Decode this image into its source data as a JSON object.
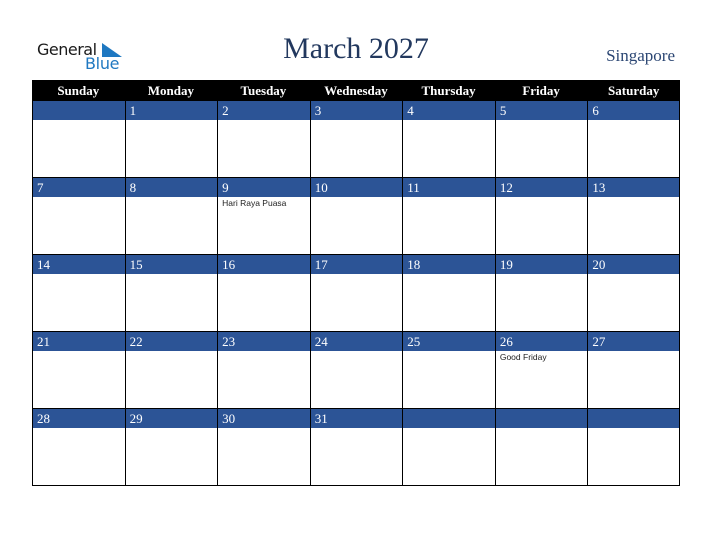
{
  "logo": {
    "line1": "General",
    "line2": "Blue"
  },
  "title": "March 2027",
  "country": "Singapore",
  "weekdays": [
    "Sunday",
    "Monday",
    "Tuesday",
    "Wednesday",
    "Thursday",
    "Friday",
    "Saturday"
  ],
  "weeks": [
    [
      {
        "day": ""
      },
      {
        "day": "1"
      },
      {
        "day": "2"
      },
      {
        "day": "3"
      },
      {
        "day": "4"
      },
      {
        "day": "5"
      },
      {
        "day": "6"
      }
    ],
    [
      {
        "day": "7"
      },
      {
        "day": "8"
      },
      {
        "day": "9",
        "event": "Hari Raya Puasa"
      },
      {
        "day": "10"
      },
      {
        "day": "11"
      },
      {
        "day": "12"
      },
      {
        "day": "13"
      }
    ],
    [
      {
        "day": "14"
      },
      {
        "day": "15"
      },
      {
        "day": "16"
      },
      {
        "day": "17"
      },
      {
        "day": "18"
      },
      {
        "day": "19"
      },
      {
        "day": "20"
      }
    ],
    [
      {
        "day": "21"
      },
      {
        "day": "22"
      },
      {
        "day": "23"
      },
      {
        "day": "24"
      },
      {
        "day": "25"
      },
      {
        "day": "26",
        "event": "Good Friday"
      },
      {
        "day": "27"
      }
    ],
    [
      {
        "day": "28"
      },
      {
        "day": "29"
      },
      {
        "day": "30"
      },
      {
        "day": "31"
      },
      {
        "day": ""
      },
      {
        "day": ""
      },
      {
        "day": ""
      }
    ]
  ],
  "colors": {
    "header_bg": "#000000",
    "day_bar": "#2c5496",
    "title": "#22385e",
    "logo_blue": "#1f78c1"
  }
}
